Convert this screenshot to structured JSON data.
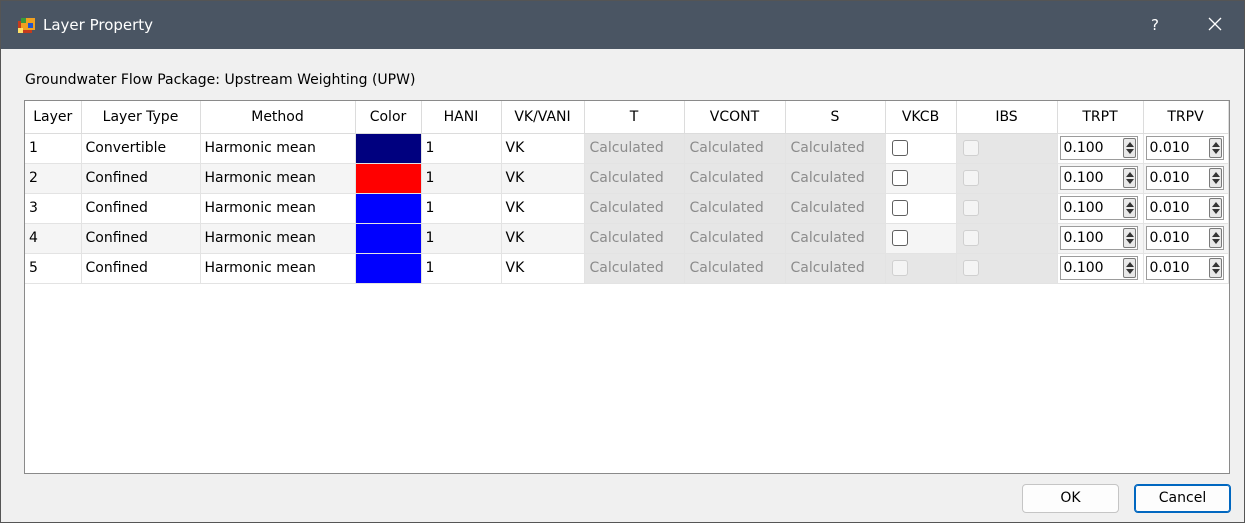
{
  "window": {
    "title": "Layer Property",
    "help_label": "?",
    "icon": "layer-property-app-icon",
    "close_icon": "close-icon"
  },
  "package_label": "Groundwater Flow Package: Upstream Weighting (UPW)",
  "table": {
    "columns": [
      "Layer",
      "Layer Type",
      "Method",
      "Color",
      "HANI",
      "VK/VANI",
      "T",
      "VCONT",
      "S",
      "VKCB",
      "IBS",
      "TRPT",
      "TRPV"
    ],
    "rows": [
      {
        "layer": "1",
        "layer_type": "Convertible",
        "method": "Harmonic mean",
        "color": "#00007f",
        "hani": "1",
        "vkvani": "VK",
        "t": "Calculated",
        "vcont": "Calculated",
        "s": "Calculated",
        "vkcb_checked": false,
        "vkcb_enabled": true,
        "ibs_checked": false,
        "ibs_enabled": false,
        "trpt": "0.100",
        "trpv": "0.010"
      },
      {
        "layer": "2",
        "layer_type": "Confined",
        "method": "Harmonic mean",
        "color": "#ff0000",
        "hani": "1",
        "vkvani": "VK",
        "t": "Calculated",
        "vcont": "Calculated",
        "s": "Calculated",
        "vkcb_checked": false,
        "vkcb_enabled": true,
        "ibs_checked": false,
        "ibs_enabled": false,
        "trpt": "0.100",
        "trpv": "0.010"
      },
      {
        "layer": "3",
        "layer_type": "Confined",
        "method": "Harmonic mean",
        "color": "#0000ff",
        "hani": "1",
        "vkvani": "VK",
        "t": "Calculated",
        "vcont": "Calculated",
        "s": "Calculated",
        "vkcb_checked": false,
        "vkcb_enabled": true,
        "ibs_checked": false,
        "ibs_enabled": false,
        "trpt": "0.100",
        "trpv": "0.010"
      },
      {
        "layer": "4",
        "layer_type": "Confined",
        "method": "Harmonic mean",
        "color": "#0000ff",
        "hani": "1",
        "vkvani": "VK",
        "t": "Calculated",
        "vcont": "Calculated",
        "s": "Calculated",
        "vkcb_checked": false,
        "vkcb_enabled": true,
        "ibs_checked": false,
        "ibs_enabled": false,
        "trpt": "0.100",
        "trpv": "0.010"
      },
      {
        "layer": "5",
        "layer_type": "Confined",
        "method": "Harmonic mean",
        "color": "#0000ff",
        "hani": "1",
        "vkvani": "VK",
        "t": "Calculated",
        "vcont": "Calculated",
        "s": "Calculated",
        "vkcb_checked": false,
        "vkcb_enabled": false,
        "ibs_checked": false,
        "ibs_enabled": false,
        "trpt": "0.100",
        "trpv": "0.010"
      }
    ]
  },
  "buttons": {
    "ok": "OK",
    "cancel": "Cancel"
  }
}
